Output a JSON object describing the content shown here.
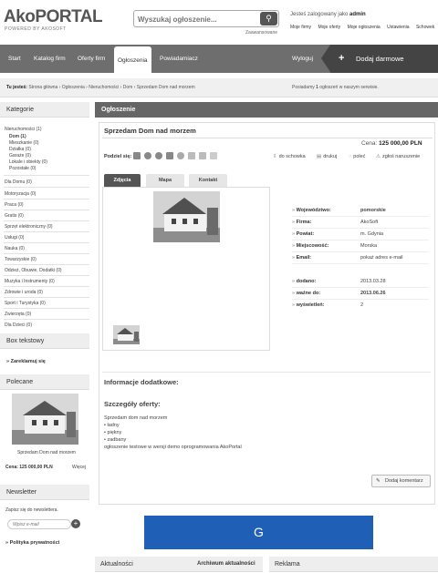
{
  "header": {
    "logo_main": "AkoPORTAL",
    "logo_sub": "POWERED BY AKOSOFT",
    "search_placeholder": "Wyszukaj ogłoszenie...",
    "advanced_search": "Zaawansowane",
    "logged_prefix": "Jesteś zalogowany jako",
    "logged_user": "admin",
    "user_links": [
      "Moje firmy",
      "Moje oferty",
      "Moje ogłoszenia",
      "Ustawienia",
      "Schowek"
    ]
  },
  "nav": {
    "items": [
      "Start",
      "Katalog firm",
      "Oferty firm",
      "Ogłoszenia",
      "Powiadamiacz"
    ],
    "active_index": 3,
    "logout": "Wyloguj",
    "add_ad": "Dodaj darmowe ogłoszenie"
  },
  "breadcrumb": {
    "prefix": "Tu jesteś:",
    "path": "Strona główna › Ogłoszenia › Nieruchomości › Dom › Sprzedam Dom nad morzem",
    "posted_prefix": "Posiadamy",
    "posted_count": "1",
    "posted_suffix": "ogłoszeń w naszym serwisie."
  },
  "sidebar": {
    "categories_title": "Kategorie",
    "categories": [
      {
        "label": "Nieruchomości (1)",
        "sub": [
          "Dom (1)",
          "Mieszkanie (0)",
          "Działka (0)",
          "Garaże (0)",
          "Lokale i obiekty (0)",
          "Pozostałe (0)"
        ]
      },
      {
        "label": "Dla Domu (0)"
      },
      {
        "label": "Motoryzacja (0)"
      },
      {
        "label": "Praca (0)"
      },
      {
        "label": "Gratis (0)"
      },
      {
        "label": "Sprzęt elektroniczny (0)"
      },
      {
        "label": "Usługi (0)"
      },
      {
        "label": "Nauka (0)"
      },
      {
        "label": "Towarzyskie (0)"
      },
      {
        "label": "Odzież, Obuwie, Dodatki (0)"
      },
      {
        "label": "Muzyka i Instrumenty (0)"
      },
      {
        "label": "Zdrowie i uroda (0)"
      },
      {
        "label": "Sport i Turystyka (0)"
      },
      {
        "label": "Zwierzęta (0)"
      },
      {
        "label": "Dla Dzieci (0)"
      }
    ],
    "textbox_title": "Box tekstowy",
    "textbox_link": "» Zareklamuj się",
    "recommended_title": "Polecane",
    "recommended_caption": "Sprzedam Dom nad morzem",
    "recommended_price": "Cena: 125 000,00 PLN",
    "recommended_more": "Więcej",
    "newsletter_title": "Newsletter",
    "newsletter_text": "Zapisz się do newslettera.",
    "newsletter_placeholder": "Wpisz e-mail",
    "privacy_link": "» Polityka prywatności"
  },
  "main": {
    "section_title": "Ogłoszenie",
    "ad_title": "Sprzedam Dom nad morzem",
    "price_label": "Cena:",
    "price_value": "125 000,00 PLN",
    "share_label": "Podziel się:",
    "actions": [
      "do schowka",
      "drukuj",
      "poleć",
      "zgłoś naruszenie"
    ],
    "tabs": [
      "Zdjęcia",
      "Mapa",
      "Kontakt"
    ],
    "details": [
      {
        "label": "Województwo:",
        "value": "pomorskie"
      },
      {
        "label": "Firma:",
        "value": "AkoSoft"
      },
      {
        "label": "Powiat:",
        "value": "m. Gdynia"
      },
      {
        "label": "Miejscowość:",
        "value": "Morska"
      },
      {
        "label": "Email:",
        "value": "pokaż adres e-mail"
      },
      {
        "label": "dodano:",
        "value": "2013.03.28"
      },
      {
        "label": "ważne do:",
        "value": "2013.06.26"
      },
      {
        "label": "wyświetleń:",
        "value": "2"
      }
    ],
    "info_title": "Informacje dodatkowe:",
    "details_title": "Szczegóły oferty:",
    "desc_line": "Sprzedam dom nad morzem",
    "bullets": [
      "ładny",
      "piękny",
      "zadbany"
    ],
    "desc_footer": "ogłoszenie testowe w wersji demo oprogramowania AkoPortal",
    "comment_button": "Dodaj komentarz"
  },
  "banner": {
    "text": "G",
    "color": "#1f5fb5"
  },
  "footer": {
    "news_title": "Aktualności",
    "news_archive": "Archiwum aktualności",
    "ads_title": "Reklama"
  }
}
